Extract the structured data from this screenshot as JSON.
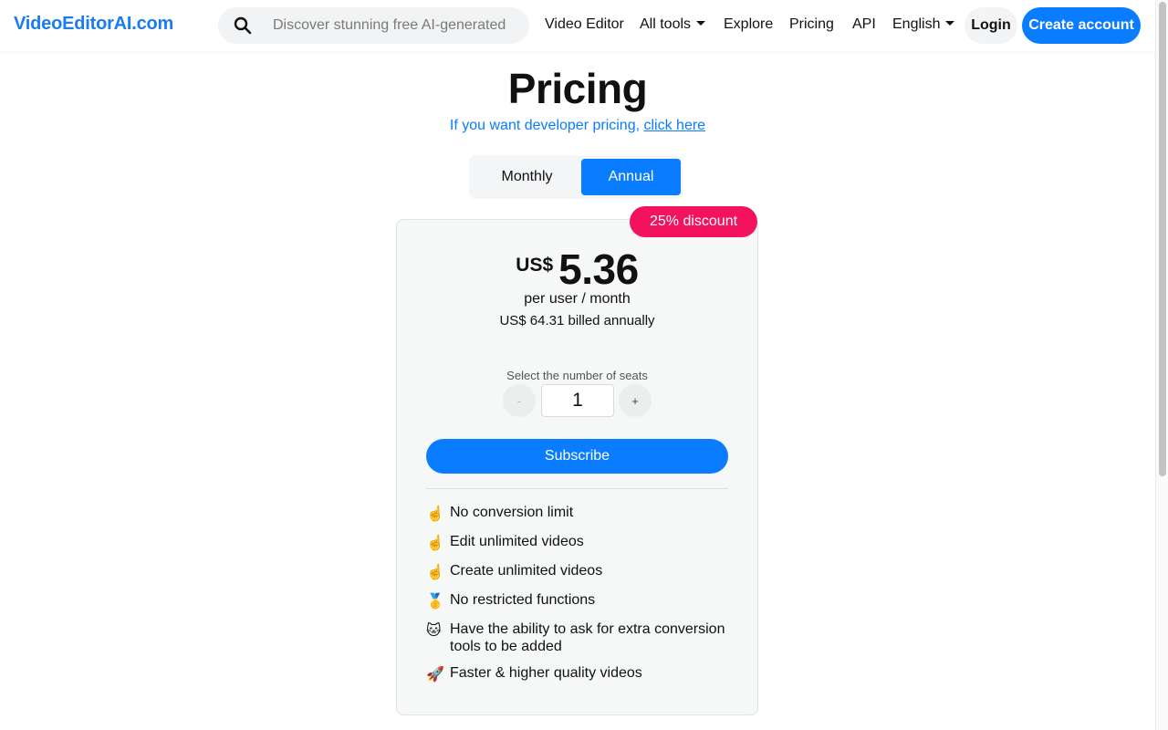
{
  "nav": {
    "brand": "VideoEditorAI.com",
    "search_placeholder": "Discover stunning free AI-generated v",
    "links": {
      "video_editor": "Video Editor",
      "all_tools": "All tools",
      "explore": "Explore",
      "pricing": "Pricing",
      "api": "API",
      "language": "English"
    },
    "login": "Login",
    "create_account": "Create account"
  },
  "page": {
    "title": "Pricing",
    "dev_text": "If you want developer pricing, ",
    "dev_link": "click here"
  },
  "billing_toggle": {
    "monthly": "Monthly",
    "annual": "Annual",
    "selected": "Annual"
  },
  "plan": {
    "discount_badge": "25% discount",
    "currency": "US$",
    "price": "5.36",
    "per_unit": "per user / month",
    "billed": "US$ 64.31 billed annually",
    "seats_label": "Select the number of seats",
    "seats_minus": "-",
    "seats_plus": "+",
    "seats_value": "1",
    "subscribe": "Subscribe",
    "features": [
      {
        "icon": "☝️",
        "text": "No conversion limit"
      },
      {
        "icon": "☝️",
        "text": "Edit unlimited videos"
      },
      {
        "icon": "☝️",
        "text": "Create unlimited videos"
      },
      {
        "icon": "🥇",
        "text": "No restricted functions"
      },
      {
        "icon": "🐱",
        "text": "Have the ability to ask for extra conversion tools to be added"
      },
      {
        "icon": "🚀",
        "text": "Faster & higher quality videos"
      }
    ]
  },
  "colors": {
    "brand_blue": "#0a7cff",
    "discount_pink": "#f2125e",
    "card_bg": "#f6f8f8"
  }
}
